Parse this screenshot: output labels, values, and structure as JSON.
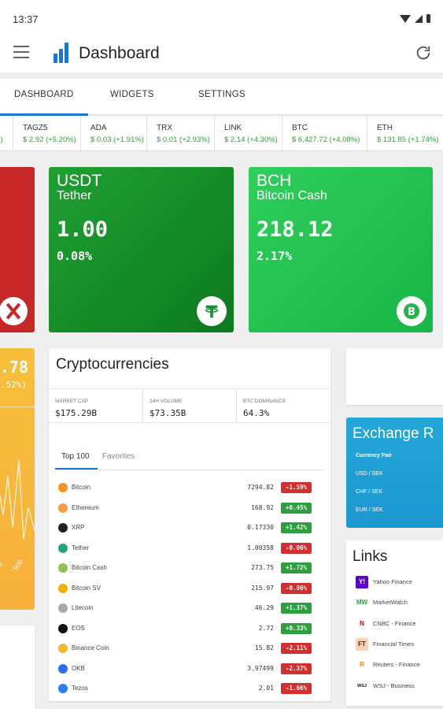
{
  "status_bar": {
    "time": "13:37"
  },
  "app_bar": {
    "title": "Dashboard"
  },
  "tabs": [
    {
      "label": "DASHBOARD",
      "active": true
    },
    {
      "label": "WIDGETS",
      "active": false
    },
    {
      "label": "SETTINGS",
      "active": false
    }
  ],
  "ticker": [
    {
      "symbol": "",
      "value": "%)"
    },
    {
      "symbol": "TAGZ5",
      "value": "$ 2.92 (+5.20%)"
    },
    {
      "symbol": "ADA",
      "value": "$ 0.03 (+1.91%)"
    },
    {
      "symbol": "TRX",
      "value": "$ 0.01 (+2.93%)"
    },
    {
      "symbol": "LINK",
      "value": "$ 2.14 (+4.30%)"
    },
    {
      "symbol": "BTC",
      "value": "$ 6,427.72 (+4.08%)"
    },
    {
      "symbol": "ETH",
      "value": "$ 131.85 (+1.74%)"
    }
  ],
  "cards": {
    "usdt": {
      "symbol": "USDT",
      "name": "Tether",
      "price": "1.00",
      "change": "0.08%",
      "color": "#14902a"
    },
    "bch": {
      "symbol": "BCH",
      "name": "Bitcoin Cash",
      "price": "218.12",
      "change": "2.17%",
      "color": "#22c350"
    },
    "yellow": {
      "price": ".78",
      "change": ".52%)",
      "sparkline_labels": [
        "00",
        "1500"
      ],
      "color": "#f6b93b"
    },
    "red": {
      "color": "#c62828"
    }
  },
  "cryptocurrencies": {
    "title": "Cryptocurrencies",
    "stats": [
      {
        "label": "MARKET CAP",
        "value": "$175.29B"
      },
      {
        "label": "24H VOLUME",
        "value": "$73.35B"
      },
      {
        "label": "BTC DOMINANCE",
        "value": "64.3%"
      }
    ],
    "list_tabs": [
      "Top 100",
      "Favorites"
    ],
    "rows": [
      {
        "name": "Bitcoin",
        "price": "7294.82",
        "change": "-1.59%",
        "up": false,
        "icon_color": "#f7931a"
      },
      {
        "name": "Ethereum",
        "price": "168.92",
        "change": "+0.45%",
        "up": true,
        "icon_color": "#f29d3f"
      },
      {
        "name": "XRP",
        "price": "0.17330",
        "change": "+1.42%",
        "up": true,
        "icon_color": "#222222"
      },
      {
        "name": "Tether",
        "price": "1.00358",
        "change": "-0.06%",
        "up": false,
        "icon_color": "#26a17b"
      },
      {
        "name": "Bitcoin Cash",
        "price": "273.75",
        "change": "+1.72%",
        "up": true,
        "icon_color": "#8dc351"
      },
      {
        "name": "Bitcoin SV",
        "price": "215.97",
        "change": "-0.86%",
        "up": false,
        "icon_color": "#eab300"
      },
      {
        "name": "Litecoin",
        "price": "46.29",
        "change": "+1.37%",
        "up": true,
        "icon_color": "#a6a9aa"
      },
      {
        "name": "EOS",
        "price": "2.72",
        "change": "+0.33%",
        "up": true,
        "icon_color": "#111111"
      },
      {
        "name": "Binance Coin",
        "price": "15.82",
        "change": "-2.11%",
        "up": false,
        "icon_color": "#f3ba2f"
      },
      {
        "name": "OKB",
        "price": "3.97499",
        "change": "-2.37%",
        "up": false,
        "icon_color": "#2d6cf0"
      },
      {
        "name": "Tezos",
        "price": "2.01",
        "change": "-1.66%",
        "up": false,
        "icon_color": "#2c7df7"
      }
    ]
  },
  "exchange": {
    "title": "Exchange R",
    "pair_label": "Currency Pair",
    "pairs": [
      "USD / SEK",
      "CHF / SEK",
      "EUR / SEK"
    ]
  },
  "links": {
    "title": "Links",
    "items": [
      {
        "name": "Yahoo Finance",
        "icon": "Y!",
        "bg": "#5f01d1",
        "fg": "#ffffff"
      },
      {
        "name": "MarketWatch",
        "icon": "MW",
        "bg": "#ffffff",
        "fg": "#2e9e3e"
      },
      {
        "name": "CNBC - Finance",
        "icon": "N",
        "bg": "#ffffff",
        "fg": "#cc0000"
      },
      {
        "name": "Financial Times",
        "icon": "FT",
        "bg": "#fcd0b1",
        "fg": "#33302e"
      },
      {
        "name": "Reuters - Finance",
        "icon": "R",
        "bg": "#ffffff",
        "fg": "#ff8000"
      },
      {
        "name": "WSJ - Business",
        "icon": "WSJ",
        "bg": "#ffffff",
        "fg": "#111111"
      }
    ]
  },
  "colors": {
    "accent": "#1976d2",
    "positive": "#2e9e3e",
    "negative": "#d32f2f"
  }
}
